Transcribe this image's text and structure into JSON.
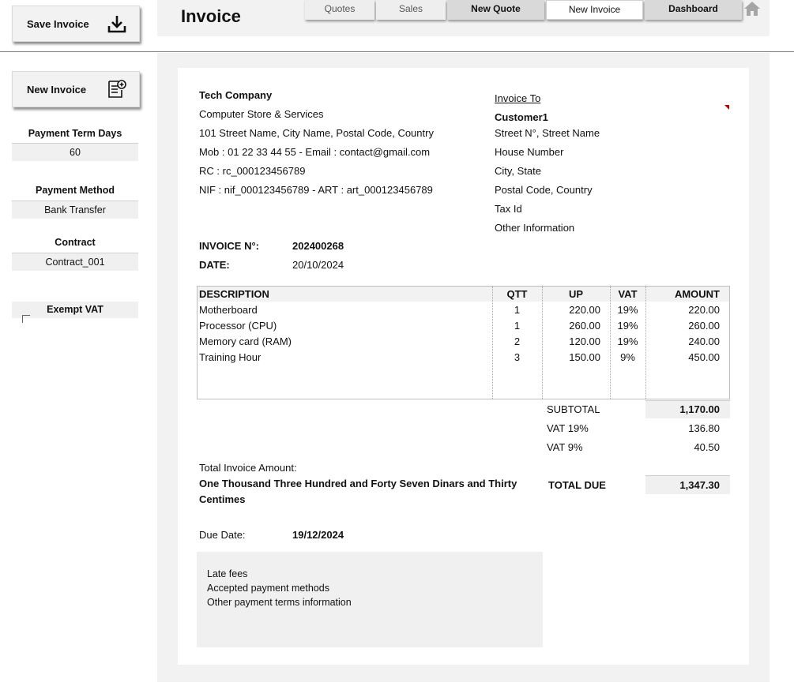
{
  "sidebar": {
    "save_label": "Save Invoice",
    "new_label": "New Invoice",
    "payment_term_title": "Payment Term Days",
    "payment_term_value": "60",
    "payment_method_title": "Payment Method",
    "payment_method_value": "Bank Transfer",
    "contract_title": "Contract",
    "contract_value": "Contract_001",
    "exempt_vat_title": "Exempt VAT"
  },
  "header": {
    "title": "Invoice",
    "tabs": [
      "Quotes",
      "Sales",
      "New Quote",
      "New Invoice",
      "Dashboard"
    ]
  },
  "company": {
    "name": "Tech Company",
    "line1": "Computer Store & Services",
    "line2": "101 Street Name, City Name, Postal Code, Country",
    "line3": "Mob : 01 22 33 44 55 - Email :  contact@gmail.com",
    "line4": "RC : rc_000123456789",
    "line5": "NIF : nif_000123456789 - ART : art_000123456789"
  },
  "customer": {
    "heading": "Invoice To",
    "name": "Customer1",
    "line1": "Street N°, Street Name",
    "line2": "House Number",
    "line3": "City, State",
    "line4": "Postal Code, Country",
    "line5": "Tax Id",
    "line6": "Other Information"
  },
  "invoice": {
    "number_label": "INVOICE N°:",
    "number": "202400268",
    "date_label": "DATE:",
    "date": "20/10/2024"
  },
  "table": {
    "headers": [
      "DESCRIPTION",
      "QTT",
      "UP",
      "VAT",
      "AMOUNT"
    ],
    "rows": [
      [
        "Motherboard",
        "1",
        "220.00",
        "19%",
        "220.00"
      ],
      [
        "Processor (CPU)",
        "1",
        "260.00",
        "19%",
        "260.00"
      ],
      [
        "Memory card (RAM)",
        "2",
        "120.00",
        "19%",
        "240.00"
      ],
      [
        "Training Hour",
        "3",
        "150.00",
        "9%",
        "450.00"
      ]
    ]
  },
  "totals": {
    "subtotal_label": "SUBTOTAL",
    "subtotal": "1,170.00",
    "vat19_label": "VAT 19%",
    "vat19": "136.80",
    "vat9_label": "VAT 9%",
    "vat9": "40.50",
    "total_due_label": "TOTAL DUE",
    "total_due": "1,347.30"
  },
  "amount_words": {
    "label": "Total Invoice Amount:",
    "line1": "One Thousand Three Hundred and Forty Seven Dinars and Thirty",
    "line2": "Centimes"
  },
  "due": {
    "label": "Due Date:",
    "value": "19/12/2024"
  },
  "notes": [
    "Late fees",
    "Accepted payment methods",
    "Other payment terms information"
  ]
}
